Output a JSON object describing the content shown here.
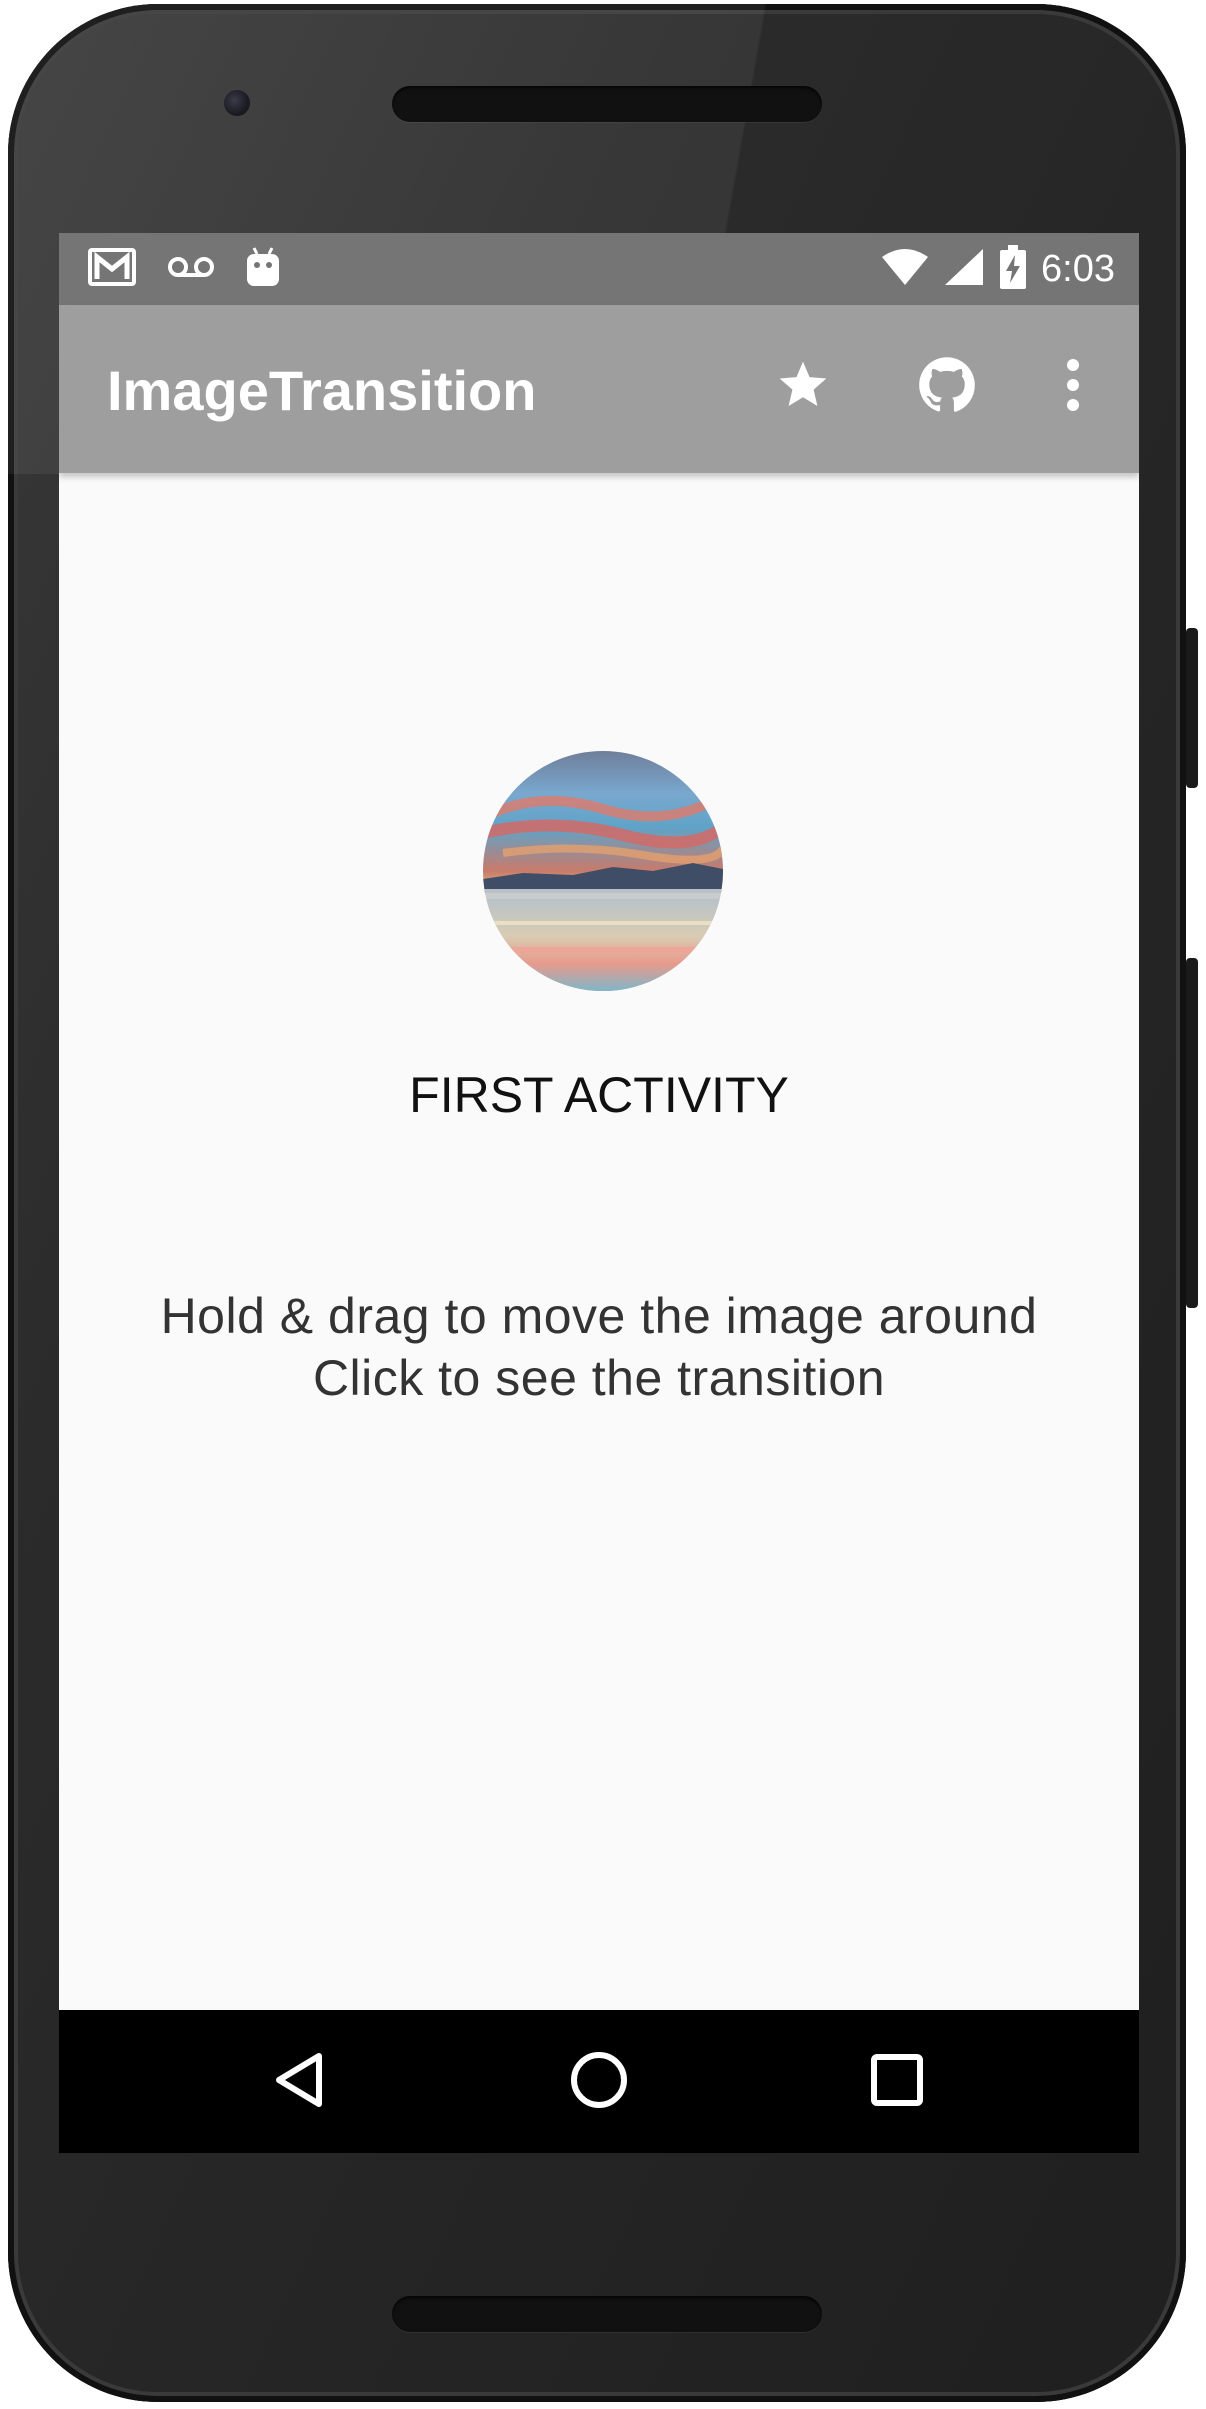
{
  "status_bar": {
    "time": "6:03",
    "icons": [
      "gmail-icon",
      "voicemail-icon",
      "android-icon",
      "wifi-icon",
      "signal-icon",
      "battery-charging-icon"
    ]
  },
  "app_bar": {
    "title": "ImageTransition",
    "actions": [
      "star-icon",
      "github-icon",
      "overflow-menu-icon"
    ]
  },
  "main": {
    "heading": "FIRST ACTIVITY",
    "instructions": [
      "Hold & drag to move the image around",
      "Click to see the transition"
    ]
  },
  "nav_bar": {
    "buttons": [
      "back-icon",
      "home-icon",
      "recents-icon"
    ]
  },
  "colors": {
    "status_bar": "#757575",
    "app_bar": "#9e9e9e",
    "background": "#fafafa",
    "nav_bar": "#000000"
  }
}
